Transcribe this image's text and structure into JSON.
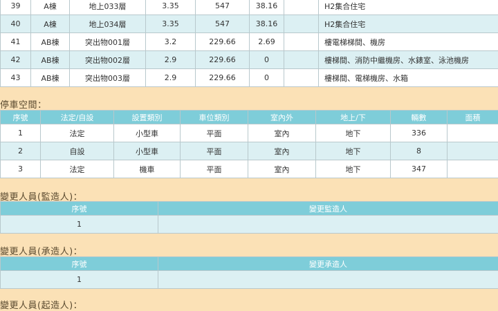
{
  "floors": {
    "rows": [
      {
        "no": "39",
        "building": "A棟",
        "floor": "地上033層",
        "height": "3.35",
        "area": "547",
        "value": "38.16",
        "extra": "",
        "use": "H2集合住宅"
      },
      {
        "no": "40",
        "building": "A棟",
        "floor": "地上034層",
        "height": "3.35",
        "area": "547",
        "value": "38.16",
        "extra": "",
        "use": "H2集合住宅"
      },
      {
        "no": "41",
        "building": "AB棟",
        "floor": "突出物001層",
        "height": "3.2",
        "area": "229.66",
        "value": "2.69",
        "extra": "",
        "use": "樓電梯梯間、機房"
      },
      {
        "no": "42",
        "building": "AB棟",
        "floor": "突出物002層",
        "height": "2.9",
        "area": "229.66",
        "value": "0",
        "extra": "",
        "use": "樓梯間、消防中繼機房、水錶室、泳池機房"
      },
      {
        "no": "43",
        "building": "AB棟",
        "floor": "突出物003層",
        "height": "2.9",
        "area": "229.66",
        "value": "0",
        "extra": "",
        "use": "樓梯間、電梯機房、水箱"
      }
    ]
  },
  "parking": {
    "title": "停車空間：",
    "headers": [
      "序號",
      "法定/自設",
      "設置類別",
      "車位類別",
      "室內外",
      "地上/下",
      "輛數",
      "面積"
    ],
    "rows": [
      [
        "1",
        "法定",
        "小型車",
        "平面",
        "室內",
        "地下",
        "336",
        ""
      ],
      [
        "2",
        "自設",
        "小型車",
        "平面",
        "室內",
        "地下",
        "8",
        ""
      ],
      [
        "3",
        "法定",
        "機車",
        "平面",
        "室內",
        "地下",
        "347",
        ""
      ]
    ]
  },
  "supervisor": {
    "title": "變更人員(監造人)：",
    "headers": [
      "序號",
      "變更監造人"
    ],
    "rows": [
      [
        "1",
        ""
      ]
    ]
  },
  "contractor": {
    "title": "變更人員(承造人)：",
    "headers": [
      "序號",
      "變更承造人"
    ],
    "rows": [
      [
        "1",
        ""
      ]
    ]
  },
  "next_section": {
    "title": "變更人員(起造人)："
  }
}
